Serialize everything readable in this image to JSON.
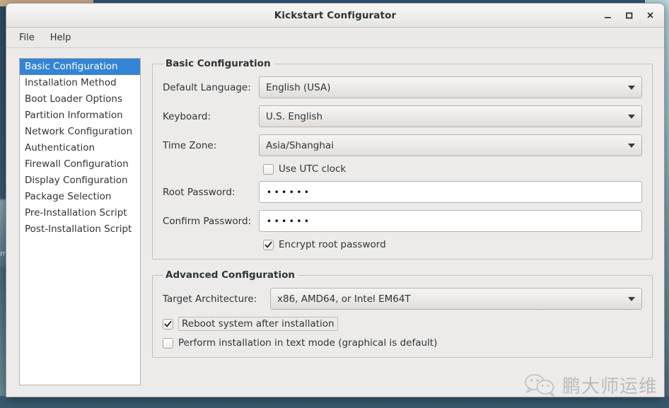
{
  "window": {
    "title": "Kickstart Configurator",
    "controls": {
      "minimize": "minimize-icon",
      "maximize": "maximize-icon",
      "close": "close-icon"
    }
  },
  "menubar": {
    "items": [
      {
        "label": "File"
      },
      {
        "label": "Help"
      }
    ]
  },
  "sidebar": {
    "items": [
      {
        "label": "Basic Configuration",
        "selected": true
      },
      {
        "label": "Installation Method",
        "selected": false
      },
      {
        "label": "Boot Loader Options",
        "selected": false
      },
      {
        "label": "Partition Information",
        "selected": false
      },
      {
        "label": "Network Configuration",
        "selected": false
      },
      {
        "label": "Authentication",
        "selected": false
      },
      {
        "label": "Firewall Configuration",
        "selected": false
      },
      {
        "label": "Display Configuration",
        "selected": false
      },
      {
        "label": "Package Selection",
        "selected": false
      },
      {
        "label": "Pre-Installation Script",
        "selected": false
      },
      {
        "label": "Post-Installation Script",
        "selected": false
      }
    ]
  },
  "basic_configuration": {
    "legend": "Basic Configuration",
    "default_language": {
      "label": "Default Language:",
      "value": "English (USA)"
    },
    "keyboard": {
      "label": "Keyboard:",
      "value": "U.S. English"
    },
    "time_zone": {
      "label": "Time Zone:",
      "value": "Asia/Shanghai"
    },
    "use_utc_clock": {
      "label": "Use UTC clock",
      "checked": false
    },
    "root_password": {
      "label": "Root Password:",
      "value": "••••••"
    },
    "confirm_password": {
      "label": "Confirm Password:",
      "value": "••••••"
    },
    "encrypt_root_password": {
      "label": "Encrypt root password",
      "checked": true
    }
  },
  "advanced_configuration": {
    "legend": "Advanced Configuration",
    "target_architecture": {
      "label": "Target Architecture:",
      "value": "x86, AMD64, or Intel EM64T"
    },
    "reboot_after_install": {
      "label": "Reboot system after installation",
      "checked": true
    },
    "text_mode_install": {
      "label": "Perform installation in text mode (graphical is default)",
      "checked": false
    }
  },
  "watermark": {
    "text": "鹏大师运维",
    "icon": "wechat-icon"
  },
  "desktop": {
    "left_label": "m",
    "colors": {
      "selection": "#3584d5",
      "window_bg": "#edebe9",
      "titlebar_bg": "#f2f1f0",
      "border": "#b3b0ac",
      "text": "#2e3436",
      "desktop_blue": "#33557a",
      "desktop_tan": "#c9ab86",
      "desktop_teal": "#a9cdd0"
    }
  }
}
